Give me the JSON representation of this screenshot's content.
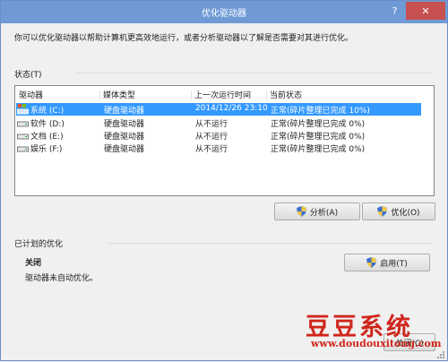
{
  "window": {
    "title": "优化驱动器",
    "help_button": "?",
    "close_button": "✕"
  },
  "description": "你可以优化驱动器以帮助计算机更高效地运行，或者分析驱动器以了解是否需要对其进行优化。",
  "status": {
    "label": "状态(T)",
    "columns": [
      "驱动器",
      "媒体类型",
      "上一次运行时间",
      "当前状态"
    ],
    "drives": [
      {
        "icon": "system-drive-icon",
        "name": "系统 (C:)",
        "media": "硬盘驱动器",
        "last_run": "2014/12/26 23:10",
        "state": "正常(碎片整理已完成 10%)",
        "selected": true
      },
      {
        "icon": "hard-drive-icon",
        "name": "软件 (D:)",
        "media": "硬盘驱动器",
        "last_run": "从不运行",
        "state": "正常(碎片整理已完成 0%)",
        "selected": false
      },
      {
        "icon": "hard-drive-icon",
        "name": "文档 (E:)",
        "media": "硬盘驱动器",
        "last_run": "从不运行",
        "state": "正常(碎片整理已完成 0%)",
        "selected": false
      },
      {
        "icon": "hard-drive-icon",
        "name": "娱乐 (F:)",
        "media": "硬盘驱动器",
        "last_run": "从不运行",
        "state": "正常(碎片整理已完成 0%)",
        "selected": false
      }
    ]
  },
  "buttons": {
    "analyze": "分析(A)",
    "optimize": "优化(O)",
    "enable": "启用(T)",
    "close": "关闭(C)"
  },
  "scheduled": {
    "label": "已计划的优化",
    "state": "关闭",
    "note": "驱动器未自动优化。"
  },
  "watermark": {
    "logo_text": "豆豆系统",
    "url": "www.doudouxitong.com"
  },
  "colors": {
    "titlebar": "#6f9ad6",
    "selection": "#3399ff",
    "close_button": "#c75050",
    "watermark": "#d0251b"
  }
}
